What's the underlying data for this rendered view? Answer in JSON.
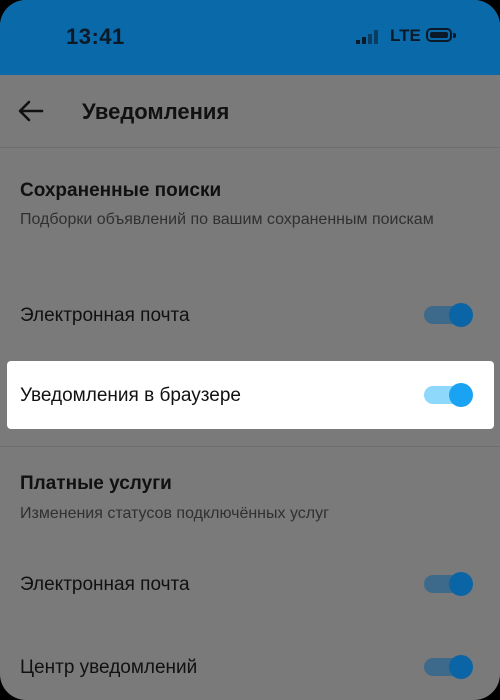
{
  "status_bar": {
    "time": "13:41",
    "network": "LTE"
  },
  "header": {
    "title": "Уведомления"
  },
  "sections": [
    {
      "title": "Сохраненные поиски",
      "description": "Подборки объявлений по вашим сохраненным поискам",
      "rows": [
        {
          "label": "Электронная почта",
          "enabled": true
        },
        {
          "label": "Уведомления в браузере",
          "enabled": true,
          "highlighted": true
        }
      ]
    },
    {
      "title": "Платные услуги",
      "description": "Изменения статусов подключённых услуг",
      "rows": [
        {
          "label": "Электронная почта",
          "enabled": true
        },
        {
          "label": "Центр уведомлений",
          "enabled": true
        }
      ]
    }
  ],
  "colors": {
    "status_bar": "#0a69a8",
    "overlay": "#7a7a7a",
    "toggle_active": "#1aa2f3",
    "toggle_track_active": "#8ed8fb"
  }
}
